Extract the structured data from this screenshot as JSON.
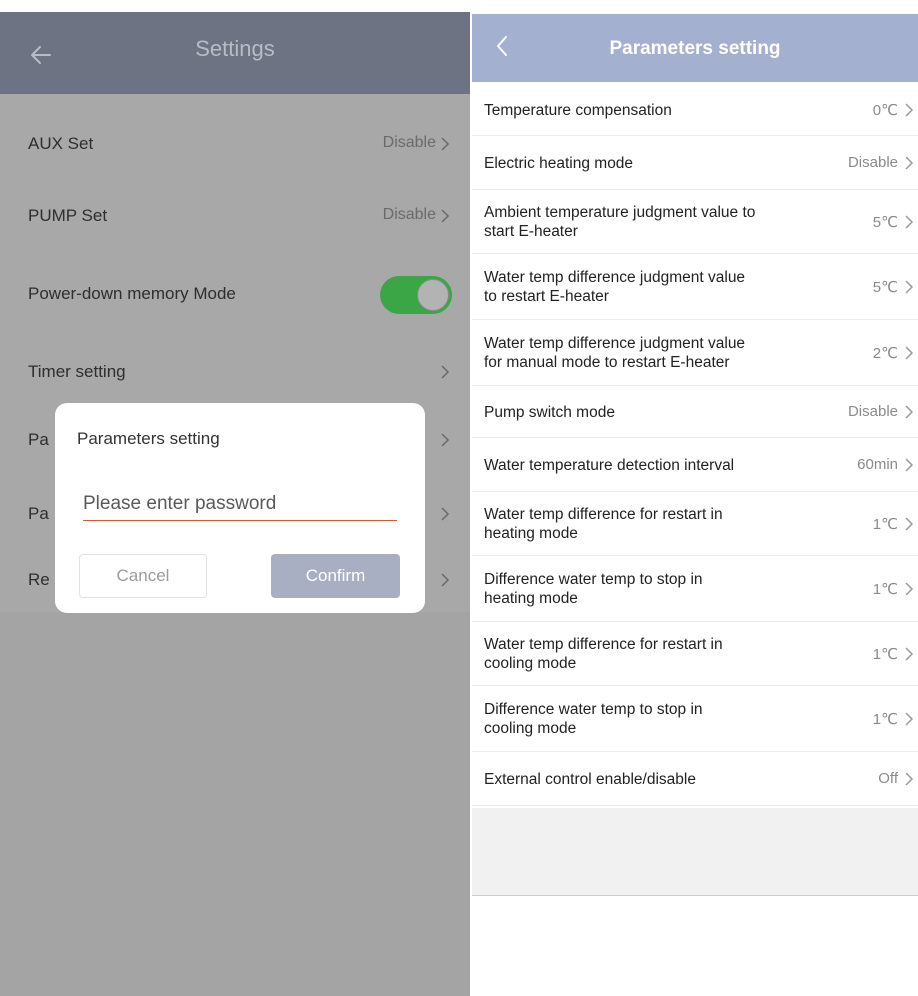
{
  "left_panel": {
    "title": "Settings",
    "rows": [
      {
        "label": "AUX Set",
        "value": "Disable"
      },
      {
        "label": "PUMP Set",
        "value": "Disable"
      },
      {
        "label": "Power-down memory Mode",
        "value": ""
      },
      {
        "label": "Timer setting",
        "value": ""
      },
      {
        "label": "Pa",
        "value": ""
      },
      {
        "label": "Pa",
        "value": ""
      },
      {
        "label": "Re",
        "value": ""
      }
    ],
    "toggle_on": true,
    "colors": {
      "toggle": "#3aa646",
      "header": "#6d7382"
    }
  },
  "dialog": {
    "title": "Parameters setting",
    "password_placeholder": "Please enter password",
    "cancel_label": "Cancel",
    "confirm_label": "Confirm"
  },
  "right_panel": {
    "title": "Parameters setting",
    "rows": [
      {
        "label": "Temperature compensation",
        "value": "0℃"
      },
      {
        "label": "Electric heating mode",
        "value": "Disable"
      },
      {
        "label": "Ambient temperature judgment value to\nstart E-heater",
        "value": "5℃"
      },
      {
        "label": "Water temp difference judgment value\nto restart E-heater",
        "value": "5℃"
      },
      {
        "label": "Water temp difference judgment value\nfor manual mode to restart E-heater",
        "value": "2℃"
      },
      {
        "label": "Pump switch mode",
        "value": "Disable"
      },
      {
        "label": "Water temperature detection interval",
        "value": "60min"
      },
      {
        "label": "Water temp difference for restart in\nheating mode",
        "value": "1℃"
      },
      {
        "label": "Difference water temp to stop in\nheating mode",
        "value": "1℃"
      },
      {
        "label": "Water temp difference for restart in\ncooling mode",
        "value": "1℃"
      },
      {
        "label": "Difference water temp to stop in\ncooling mode",
        "value": "1℃"
      },
      {
        "label": "External control enable/disable",
        "value": "Off"
      }
    ],
    "colors": {
      "header": "#a3b0d0"
    }
  }
}
